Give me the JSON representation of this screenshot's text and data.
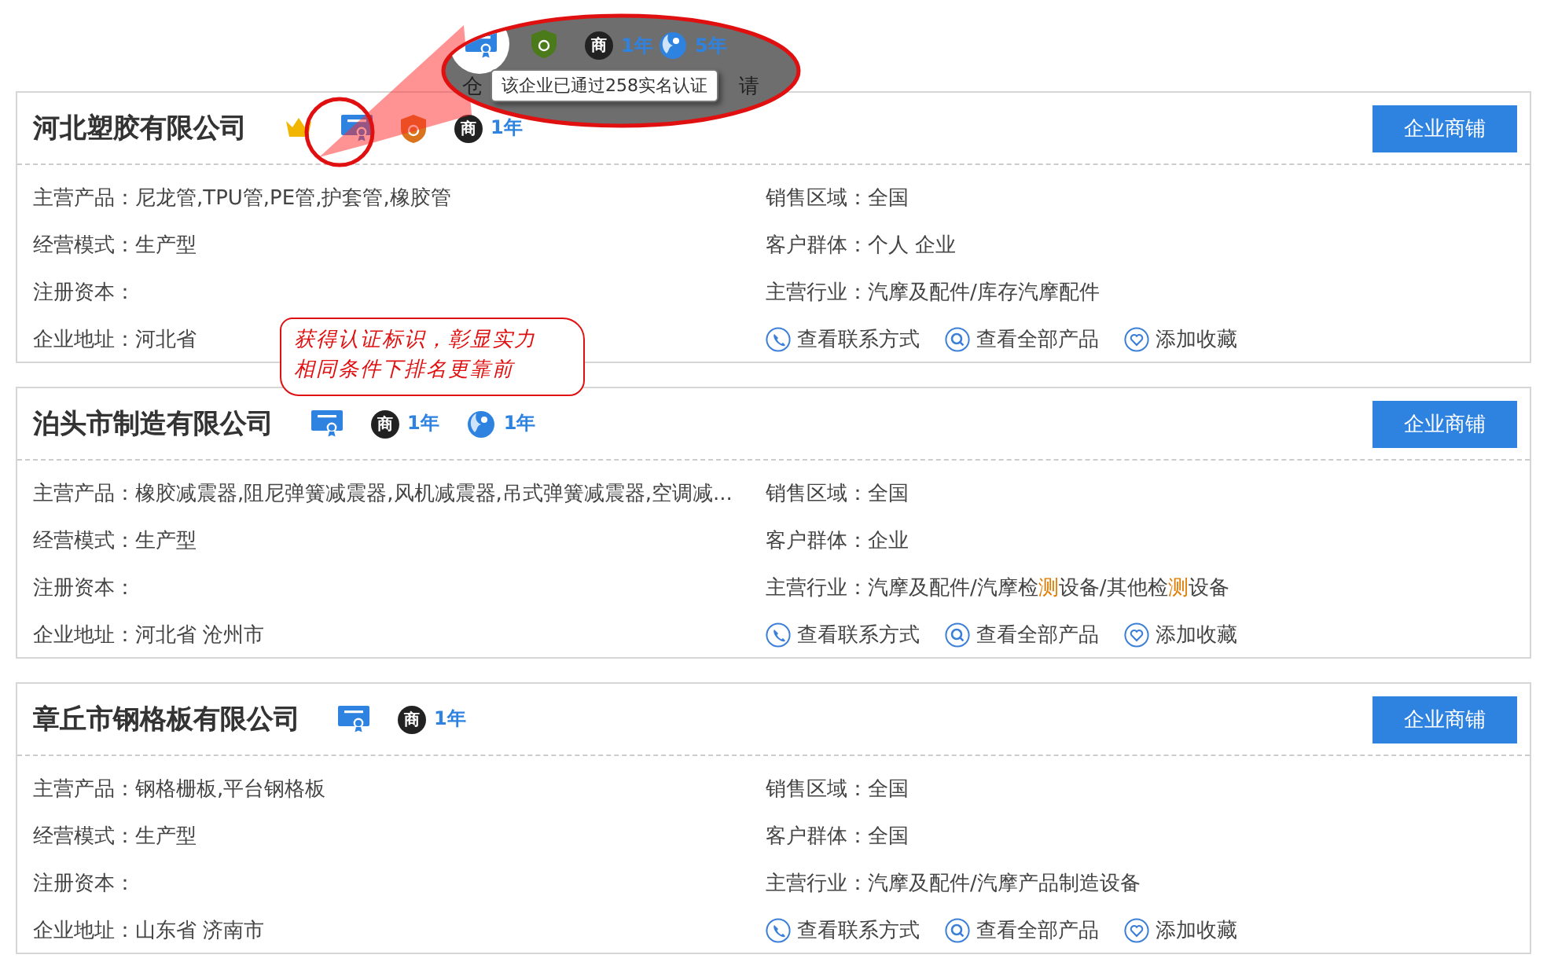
{
  "callout": {
    "badges": [
      {
        "kind": "cert"
      },
      {
        "kind": "shield"
      },
      {
        "kind": "trade",
        "mark": "商",
        "text": "1年"
      },
      {
        "kind": "globe",
        "text": "5年"
      }
    ],
    "fragments": [
      "仓",
      "请"
    ],
    "tooltip": "该企业已通过258实名认证"
  },
  "note": {
    "lines": [
      "获得认证标识，彰显实力",
      "相同条件下排名更靠前"
    ]
  },
  "companies": [
    {
      "name": "河北塑胶有限公司",
      "badges": [
        {
          "kind": "crown"
        },
        {
          "kind": "cert"
        },
        {
          "kind": "shield"
        },
        {
          "kind": "trade",
          "mark": "商",
          "text": "1年"
        }
      ],
      "button": "企业商铺",
      "left": [
        "主营产品：尼龙管,TPU管,PE管,护套管,橡胶管",
        "经营模式：生产型",
        "注册资本：",
        "企业地址：河北省"
      ],
      "right": [
        "销售区域：全国",
        "客户群体：个人 企业",
        "主营行业：汽摩及配件/库存汽摩配件"
      ],
      "actions": [
        {
          "kind": "contact",
          "label": "查看联系方式"
        },
        {
          "kind": "products",
          "label": "查看全部产品"
        },
        {
          "kind": "favorite",
          "label": "添加收藏"
        }
      ]
    },
    {
      "name": "泊头市制造有限公司",
      "badges": [
        {
          "kind": "cert"
        },
        {
          "kind": "trade",
          "mark": "商",
          "text": "1年"
        },
        {
          "kind": "globe",
          "text": "1年"
        }
      ],
      "button": "企业商铺",
      "left": [
        "主营产品：橡胶减震器,阻尼弹簧减震器,风机减震器,吊式弹簧减震器,空调减...",
        "经营模式：生产型",
        "注册资本：",
        "企业地址：河北省 沧州市"
      ],
      "right": [
        "销售区域：全国",
        "客户群体：企业",
        "主营行业：汽摩及配件/汽摩检**测**设备/其他检**测**设备"
      ],
      "actions": [
        {
          "kind": "contact",
          "label": "查看联系方式"
        },
        {
          "kind": "products",
          "label": "查看全部产品"
        },
        {
          "kind": "favorite",
          "label": "添加收藏"
        }
      ]
    },
    {
      "name": "章丘市钢格板有限公司",
      "badges": [
        {
          "kind": "cert"
        },
        {
          "kind": "trade",
          "mark": "商",
          "text": "1年"
        }
      ],
      "button": "企业商铺",
      "left": [
        "主营产品：钢格栅板,平台钢格板",
        "经营模式：生产型",
        "注册资本：",
        "企业地址：山东省 济南市"
      ],
      "right": [
        "销售区域：全国",
        "客户群体：全国",
        "主营行业：汽摩及配件/汽摩产品制造设备"
      ],
      "actions": [
        {
          "kind": "contact",
          "label": "查看联系方式"
        },
        {
          "kind": "products",
          "label": "查看全部产品"
        },
        {
          "kind": "favorite",
          "label": "添加收藏"
        }
      ]
    }
  ]
}
